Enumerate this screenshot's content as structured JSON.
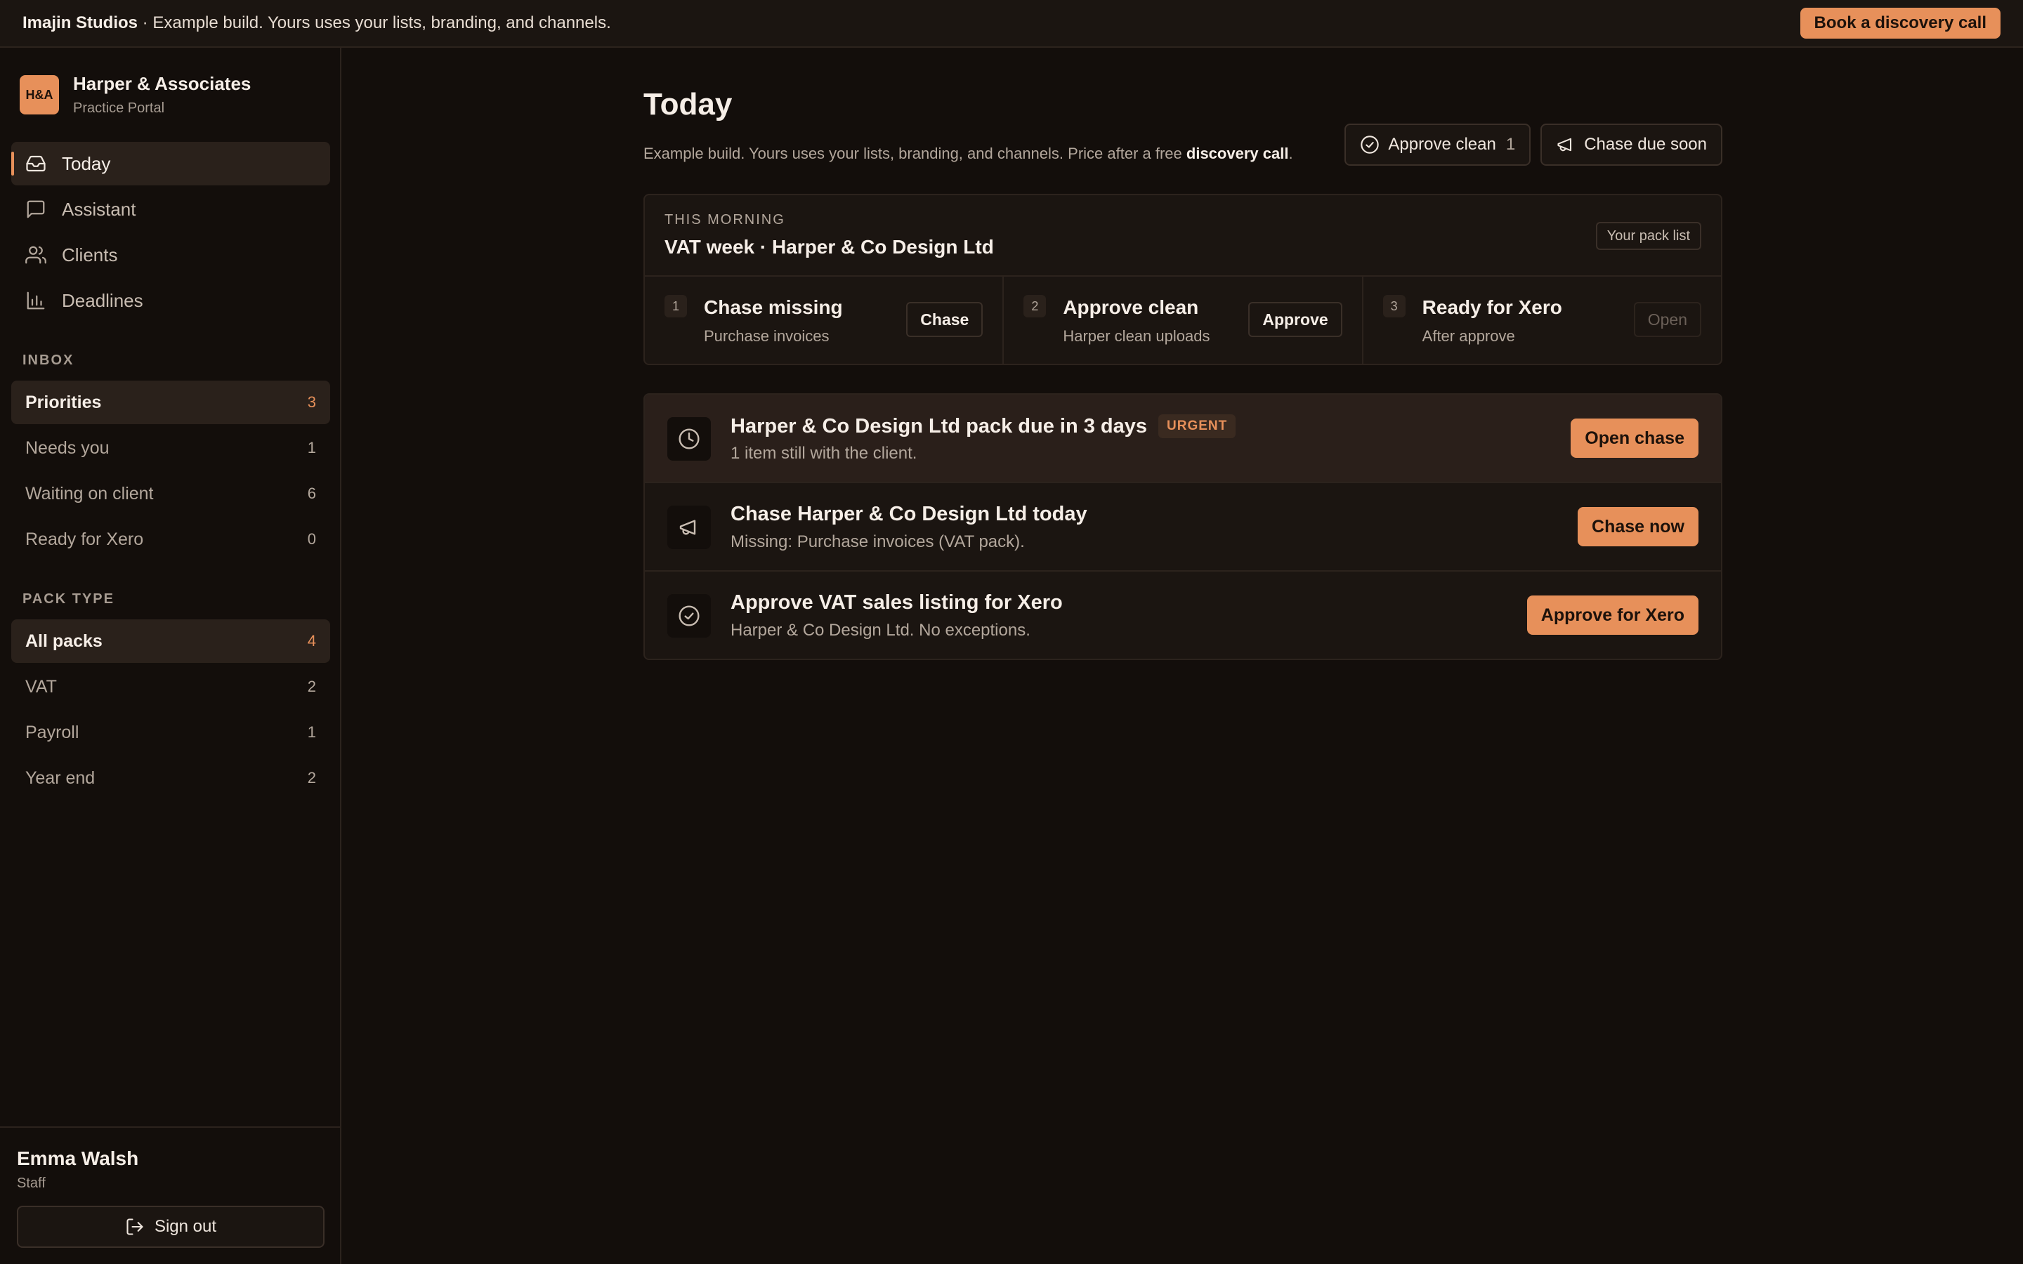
{
  "banner": {
    "brand": "Imajin Studios",
    "text": " · Example build. Yours uses your lists, branding, and channels.",
    "cta": "Book a discovery call"
  },
  "sidebar": {
    "logo": "H&A",
    "practice_name": "Harper & Associates",
    "practice_sub": "Practice Portal",
    "nav": [
      {
        "label": "Today",
        "icon": "inbox-icon",
        "active": true
      },
      {
        "label": "Assistant",
        "icon": "chat-icon",
        "active": false
      },
      {
        "label": "Clients",
        "icon": "users-icon",
        "active": false
      },
      {
        "label": "Deadlines",
        "icon": "bar-chart-icon",
        "active": false
      }
    ],
    "inbox_label": "INBOX",
    "inbox": [
      {
        "label": "Priorities",
        "count": "3",
        "active": true
      },
      {
        "label": "Needs you",
        "count": "1",
        "active": false
      },
      {
        "label": "Waiting on client",
        "count": "6",
        "active": false
      },
      {
        "label": "Ready for Xero",
        "count": "0",
        "active": false
      }
    ],
    "pack_label": "PACK TYPE",
    "packs": [
      {
        "label": "All packs",
        "count": "4",
        "active": true
      },
      {
        "label": "VAT",
        "count": "2",
        "active": false
      },
      {
        "label": "Payroll",
        "count": "1",
        "active": false
      },
      {
        "label": "Year end",
        "count": "2",
        "active": false
      }
    ],
    "user": {
      "name": "Emma Walsh",
      "role": "Staff",
      "signout": "Sign out"
    }
  },
  "main": {
    "title": "Today",
    "subtitle_pre": "Example build. Yours uses your lists, branding, and channels. Price after a free ",
    "subtitle_link": "discovery call",
    "subtitle_post": ".",
    "actions": {
      "approve_clean": "Approve clean",
      "approve_clean_count": "1",
      "chase_due": "Chase due soon"
    },
    "morning": {
      "eyebrow": "THIS MORNING",
      "title": "VAT week · Harper & Co Design Ltd",
      "pack_list": "Your pack list",
      "steps": [
        {
          "num": "1",
          "title": "Chase missing",
          "sub": "Purchase invoices",
          "button": "Chase"
        },
        {
          "num": "2",
          "title": "Approve clean",
          "sub": "Harper clean uploads",
          "button": "Approve"
        },
        {
          "num": "3",
          "title": "Ready for Xero",
          "sub": "After approve",
          "button": "Open"
        }
      ]
    },
    "tasks": [
      {
        "title": "Harper & Co Design Ltd pack due in 3 days",
        "badge": "URGENT",
        "sub": "1 item still with the client.",
        "button": "Open chase",
        "icon": "clock-icon"
      },
      {
        "title": "Chase Harper & Co Design Ltd today",
        "sub": "Missing: Purchase invoices (VAT pack).",
        "button": "Chase now",
        "icon": "megaphone-icon"
      },
      {
        "title": "Approve VAT sales listing for Xero",
        "sub": "Harper & Co Design Ltd. No exceptions.",
        "button": "Approve for Xero",
        "icon": "check-circle-icon"
      }
    ]
  },
  "colors": {
    "accent": "#e7905a",
    "background": "#130e0b",
    "surface": "#1b1511",
    "border": "#2c231d"
  }
}
